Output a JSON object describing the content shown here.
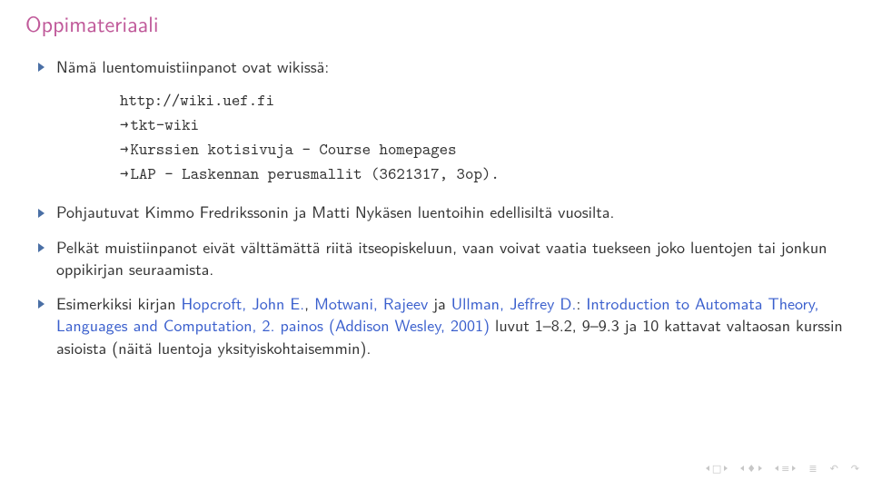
{
  "title": "Oppimateriaali",
  "items": [
    {
      "text": "Nämä luentomuistiinpanot ovat wikissä:",
      "sub": {
        "url": "http://wiki.uef.fi",
        "lines": [
          "tkt-wiki",
          "Kurssien kotisivuja - Course homepages",
          "LAP - Laskennan perusmallit (3621317, 3op)."
        ]
      }
    },
    {
      "text": "Pohjautuvat Kimmo Fredrikssonin ja Matti Nykäsen luentoihin edellisiltä vuosilta."
    },
    {
      "text": "Pelkät muistiinpanot eivät välttämättä riitä itseopiskeluun, vaan voivat vaatia tuekseen joko luentojen tai jonkun oppikirjan seuraamista."
    },
    {
      "rich": [
        {
          "t": "Esimerkiksi kirjan "
        },
        {
          "t": "Hopcroft, John E.",
          "c": "blue"
        },
        {
          "t": ", "
        },
        {
          "t": "Motwani, Rajeev",
          "c": "blue"
        },
        {
          "t": " ja "
        },
        {
          "t": "Ullman, Jeffrey D.",
          "c": "blue"
        },
        {
          "t": ": "
        },
        {
          "t": "Introduction to Automata Theory, Languages and Computation, 2. painos (Addison Wesley, 2001)",
          "c": "blue"
        },
        {
          "t": "  luvut 1–8.2, 9–9.3 ja 10 kattavat valtaosan kurssin asioista (näitä luentoja yksityiskohtaisemmin)."
        }
      ]
    }
  ]
}
